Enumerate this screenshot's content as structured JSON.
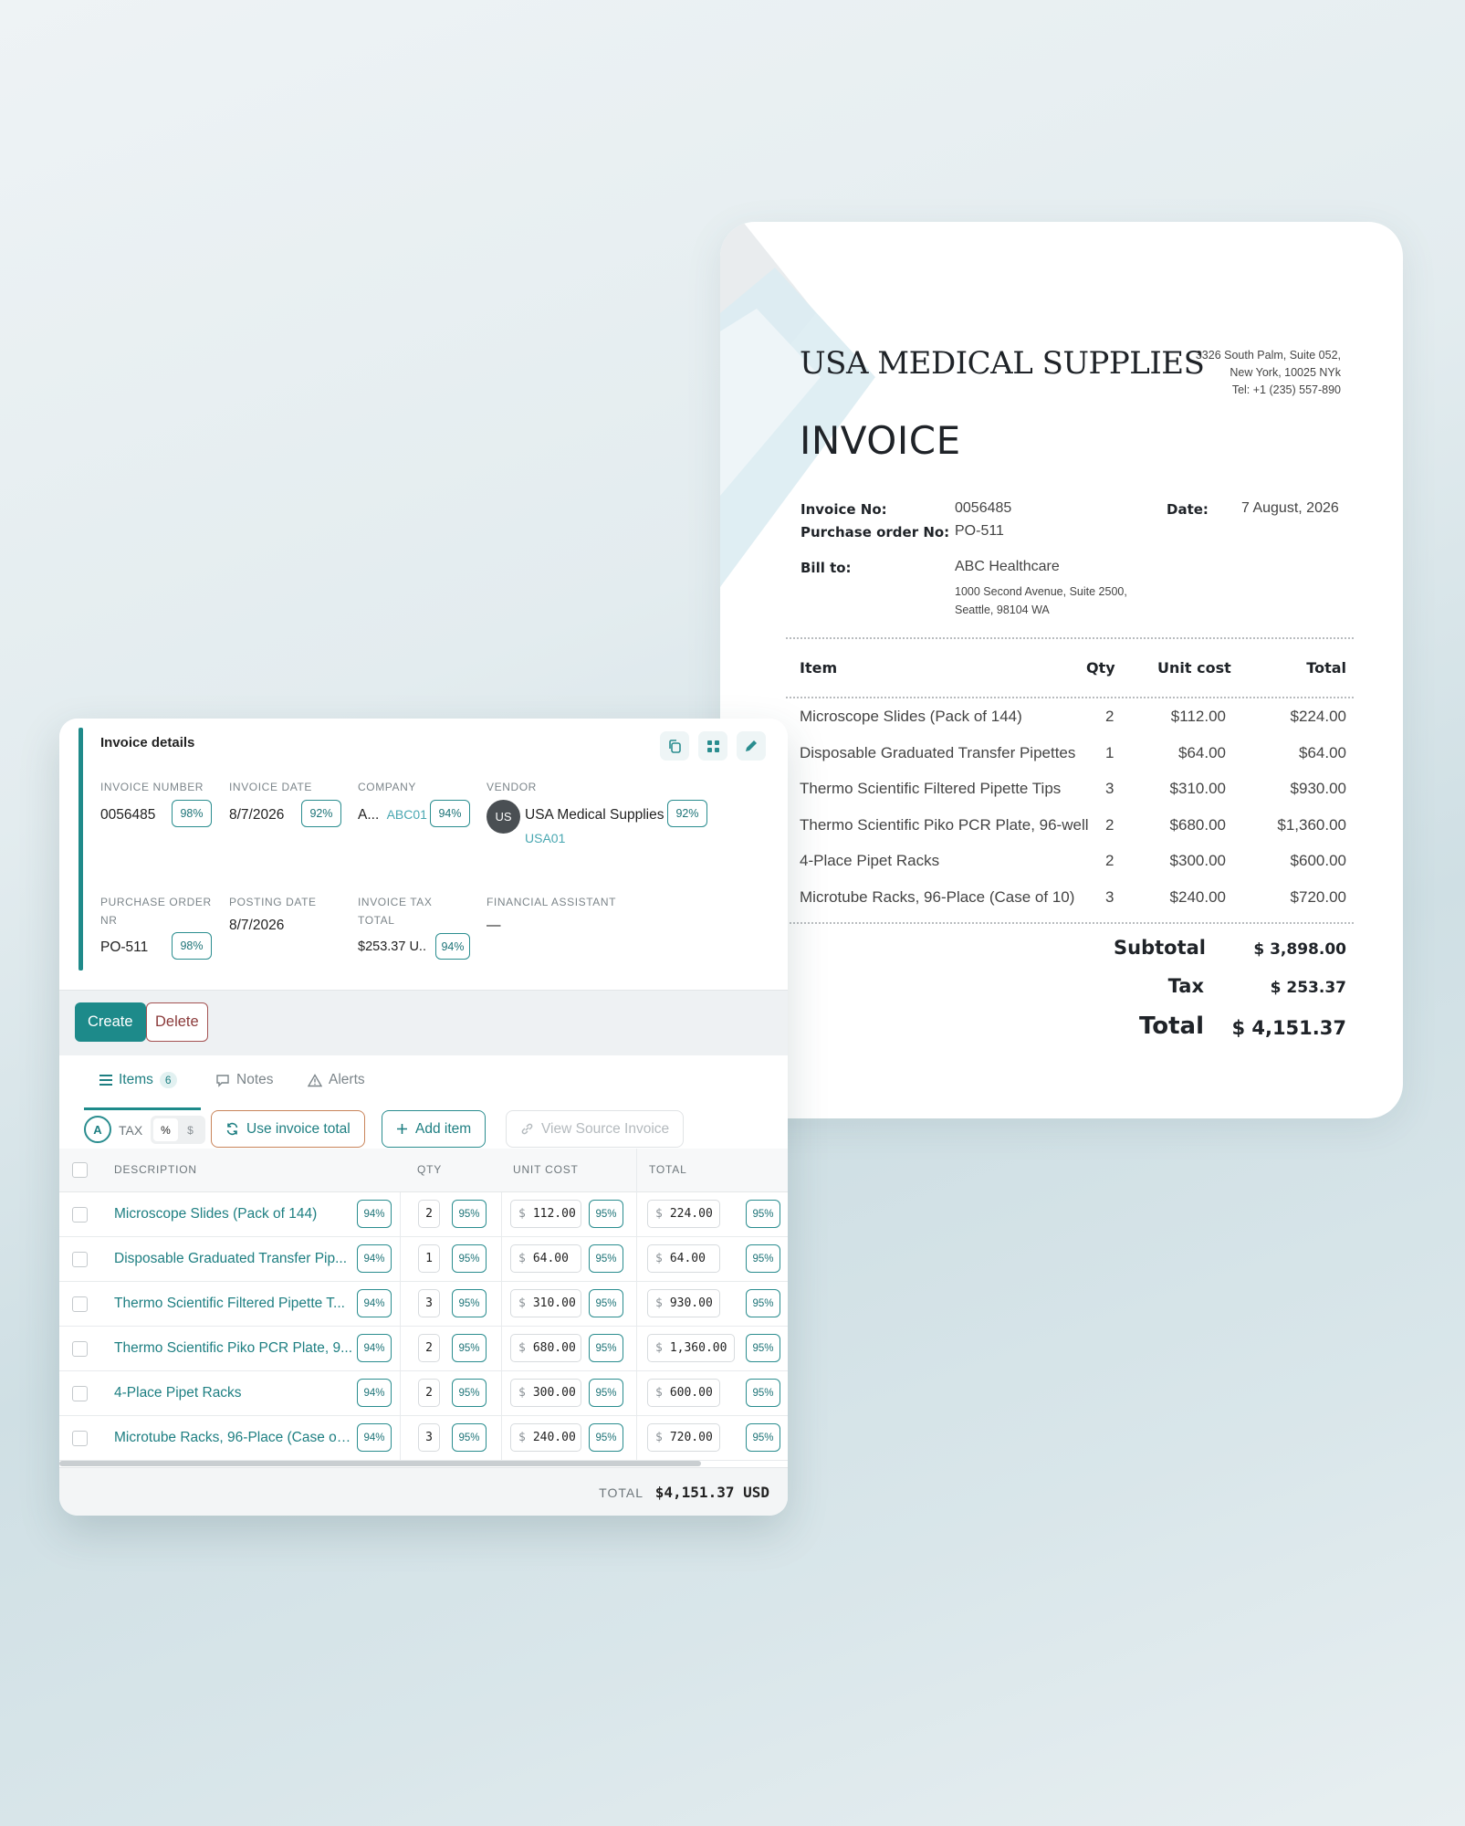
{
  "invoice_doc": {
    "company": "USA MEDICAL SUPPLIES",
    "address_lines": [
      "3326 South Palm, Suite 052,",
      "New York, 10025 NYk",
      "Tel: +1 (235) 557-890"
    ],
    "title": "INVOICE",
    "invoice_no_label": "Invoice No:",
    "invoice_no": "0056485",
    "po_label": "Purchase order No:",
    "po": "PO-511",
    "date_label": "Date:",
    "date": "7 August, 2026",
    "bill_to_label": "Bill to:",
    "bill_to_name": "ABC Healthcare",
    "bill_to_addr1": "1000 Second Avenue, Suite 2500,",
    "bill_to_addr2": "Seattle, 98104 WA",
    "headers": {
      "item": "Item",
      "qty": "Qty",
      "unit_cost": "Unit cost",
      "total": "Total"
    },
    "rows": [
      {
        "item": "Microscope Slides (Pack of 144)",
        "qty": "2",
        "unit": "$112.00",
        "total": "$224.00"
      },
      {
        "item": "Disposable Graduated Transfer Pipettes",
        "qty": "1",
        "unit": "$64.00",
        "total": "$64.00"
      },
      {
        "item": "Thermo Scientific Filtered Pipette Tips",
        "qty": "3",
        "unit": "$310.00",
        "total": "$930.00"
      },
      {
        "item": "Thermo Scientific Piko PCR Plate, 96-well",
        "qty": "2",
        "unit": "$680.00",
        "total": "$1,360.00"
      },
      {
        "item": "4-Place Pipet Racks",
        "qty": "2",
        "unit": "$300.00",
        "total": "$600.00"
      },
      {
        "item": "Microtube Racks, 96-Place (Case of 10)",
        "qty": "3",
        "unit": "$240.00",
        "total": "$720.00"
      }
    ],
    "subtotal_label": "Subtotal",
    "subtotal": "$ 3,898.00",
    "tax_label": "Tax",
    "tax": "$ 253.37",
    "total_label": "Total",
    "total": "$ 4,151.37"
  },
  "details": {
    "title": "Invoice details",
    "invoice_number_label": "INVOICE NUMBER",
    "invoice_number": "0056485",
    "invoice_number_conf": "98%",
    "invoice_date_label": "INVOICE DATE",
    "invoice_date": "8/7/2026",
    "invoice_date_conf": "92%",
    "company_label": "COMPANY",
    "company_short": "A...",
    "company_code": "ABC01",
    "company_conf": "94%",
    "vendor_label": "VENDOR",
    "vendor_initials": "US",
    "vendor_name": "USA Medical Supplies",
    "vendor_code": "USA01",
    "vendor_conf": "92%",
    "po_label_1": "PURCHASE ORDER",
    "po_label_2": "NR",
    "po_value": "PO-511",
    "po_conf": "98%",
    "posting_date_label": "POSTING DATE",
    "posting_date": "8/7/2026",
    "tax_total_label_1": "INVOICE TAX",
    "tax_total_label_2": "TOTAL",
    "tax_total": "$253.37 U..",
    "tax_total_conf": "94%",
    "financial_assistant_label": "FINANCIAL ASSISTANT",
    "financial_assistant": "—"
  },
  "actions": {
    "create": "Create",
    "delete": "Delete"
  },
  "tabs": {
    "items": "Items",
    "items_count": "6",
    "notes": "Notes",
    "alerts": "Alerts"
  },
  "toolbar": {
    "auto_badge": "A",
    "tax_label": "TAX",
    "pct": "%",
    "dollar": "$",
    "use_invoice_total": "Use invoice total",
    "add_item": "Add item",
    "view_source": "View Source Invoice"
  },
  "grid": {
    "headers": {
      "description": "DESCRIPTION",
      "qty": "QTY",
      "unit_cost": "UNIT COST",
      "total": "TOTAL"
    },
    "rows": [
      {
        "desc": "Microscope Slides (Pack of 144)",
        "desc_conf": "94%",
        "qty": "2",
        "qty_conf": "95%",
        "unit": "112.00",
        "unit_conf": "95%",
        "total": "224.00",
        "total_conf": "95%"
      },
      {
        "desc": "Disposable Graduated Transfer Pip...",
        "desc_conf": "94%",
        "qty": "1",
        "qty_conf": "95%",
        "unit": "64.00",
        "unit_conf": "95%",
        "total": "64.00",
        "total_conf": "95%"
      },
      {
        "desc": "Thermo Scientific Filtered Pipette T...",
        "desc_conf": "94%",
        "qty": "3",
        "qty_conf": "95%",
        "unit": "310.00",
        "unit_conf": "95%",
        "total": "930.00",
        "total_conf": "95%"
      },
      {
        "desc": "Thermo Scientific Piko PCR Plate, 9...",
        "desc_conf": "94%",
        "qty": "2",
        "qty_conf": "95%",
        "unit": "680.00",
        "unit_conf": "95%",
        "total": "1,360.00",
        "total_conf": "95%"
      },
      {
        "desc": "4-Place Pipet Racks",
        "desc_conf": "94%",
        "qty": "2",
        "qty_conf": "95%",
        "unit": "300.00",
        "unit_conf": "95%",
        "total": "600.00",
        "total_conf": "95%"
      },
      {
        "desc": "Microtube Racks, 96-Place (Case of ...",
        "desc_conf": "94%",
        "qty": "3",
        "qty_conf": "95%",
        "unit": "240.00",
        "unit_conf": "95%",
        "total": "720.00",
        "total_conf": "95%"
      }
    ],
    "currency": "$"
  },
  "footer": {
    "total_label": "TOTAL",
    "total_value": "$4,151.37 USD"
  },
  "colors": {
    "accent": "#1d8a8a",
    "delete": "#a45252",
    "link": "#48a7b1"
  }
}
